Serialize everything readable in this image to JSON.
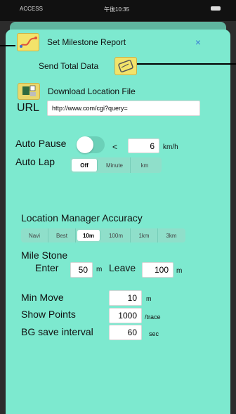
{
  "status_bar": {
    "carrier": "ACCESS",
    "time": "午後10:35"
  },
  "header": {
    "title": "Set Milestone Report",
    "close_glyph": "×"
  },
  "send_total": {
    "label": "Send Total Data"
  },
  "download": {
    "label": "Download Location File",
    "url_label": "URL",
    "url_value": "http://www.com/cgi?query="
  },
  "auto_pause": {
    "label": "Auto Pause",
    "lt": "<",
    "speed_value": "6",
    "unit": "km/h",
    "toggle_on": false
  },
  "auto_lap": {
    "label": "Auto Lap",
    "options": [
      "Off",
      "Minute",
      "km"
    ],
    "selected": 0
  },
  "accuracy": {
    "label": "Location Manager Accuracy",
    "options": [
      "Navi",
      "Best",
      "10m",
      "100m",
      "1km",
      "3km"
    ],
    "selected": 2
  },
  "milestone": {
    "label": "Mile Stone",
    "enter_label": "Enter",
    "enter_value": "50",
    "enter_unit": "m",
    "leave_label": "Leave",
    "leave_value": "100",
    "leave_unit": "m"
  },
  "min_move": {
    "label": "Min Move",
    "value": "10",
    "unit": "m"
  },
  "show_points": {
    "label": "Show Points",
    "value": "1000",
    "unit": "/trace"
  },
  "bg_save": {
    "label": "BG save interval",
    "value": "60",
    "unit": "sec"
  }
}
